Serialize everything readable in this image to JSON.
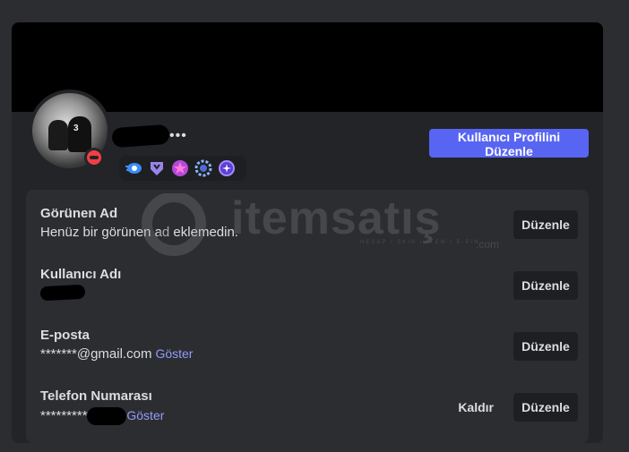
{
  "profile": {
    "name_suffix": "•••",
    "badges": [
      "nitro-boost-icon",
      "hypesquad-balance-icon",
      "quest-star-icon",
      "booster-badge-icon",
      "orbs-badge-icon"
    ],
    "edit_profile_label": "Kullanıcı Profilini Düzenle"
  },
  "fields": [
    {
      "label": "Görünen Ad",
      "value": "Henüz bir görünen ad eklemedin.",
      "edit": "Düzenle"
    },
    {
      "label": "Kullanıcı Adı",
      "value": "",
      "edit": "Düzenle"
    },
    {
      "label": "E-posta",
      "value": "*******@gmail.com",
      "reveal": "Göster",
      "edit": "Düzenle"
    },
    {
      "label": "Telefon Numarası",
      "value": "**********",
      "reveal": "Göster",
      "remove": "Kaldır",
      "edit": "Düzenle"
    }
  ],
  "watermark": {
    "brand": "itemsatış",
    "tagline": "HESAP / SKIN / ITEM / E-PIN",
    "domain": ".com"
  },
  "colors": {
    "accent": "#5865f2",
    "link": "#949cf7",
    "status_dnd": "#f23f43",
    "background": "#2b2d31",
    "card": "#232428"
  }
}
